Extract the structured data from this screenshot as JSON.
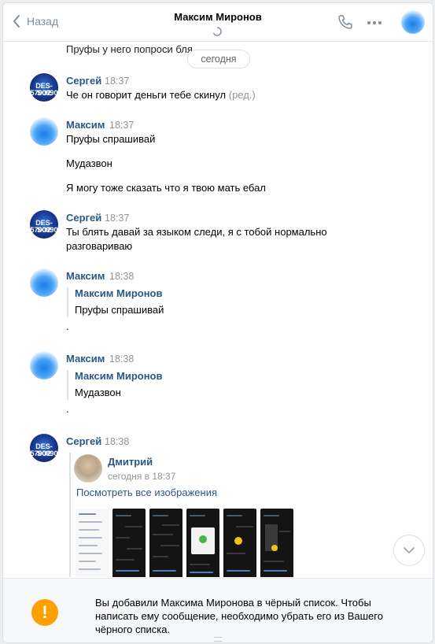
{
  "header": {
    "back_label": "Назад",
    "title": "Максим Миронов"
  },
  "date_pill": "сегодня",
  "messages": [
    {
      "text": "Пруфы у него попроси бля"
    },
    {
      "author": "Сергей",
      "time": "18:37",
      "text": "Че он говорит деньги тебе скинул",
      "edited": "(ред.)",
      "avatar_text": [
        "DES-SO2",
        "5700990"
      ]
    },
    {
      "author": "Максим",
      "time": "18:37",
      "lines": [
        "Пруфы спрашивай",
        "Мудазвон",
        "Я могу тоже сказать что я твою мать ебал"
      ]
    },
    {
      "author": "Сергей",
      "time": "18:37",
      "lines": [
        "Ты блять давай за языком следи, я с тобой нормально",
        "разговариваю"
      ],
      "avatar_text": [
        "DES-SO2",
        "5700990"
      ]
    },
    {
      "author": "Максим",
      "time": "18:38",
      "quote_author": "Максим Миронов",
      "quote_text": "Пруфы спрашивай",
      "text": "."
    },
    {
      "author": "Максим",
      "time": "18:38",
      "quote_author": "Максим Миронов",
      "quote_text": "Мудазвон",
      "text": "."
    },
    {
      "author": "Сергей",
      "time": "18:38",
      "avatar_text": [
        "DES-SO2",
        "5700990"
      ],
      "forward": {
        "author": "Дмитрий",
        "time": "сегодня в 18:37",
        "link": "Посмотреть все изображения"
      }
    }
  ],
  "notice": {
    "text": "Вы добавили Максима Миронова в чёрный список. Чтобы написать ему сообщение, необходимо убрать его из Вашего чёрного списка.",
    "icon": "exclamation-icon",
    "icon_symbol": "!",
    "accent_color": "#ffa000"
  },
  "colors": {
    "link": "#2a5885",
    "time": "#939393"
  }
}
